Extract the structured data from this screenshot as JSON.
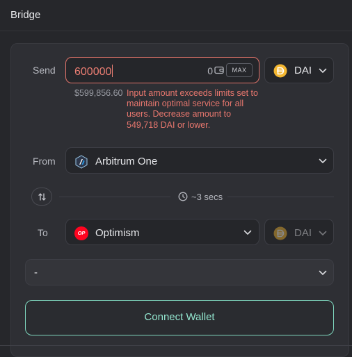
{
  "header": {
    "title": "Bridge"
  },
  "send": {
    "label": "Send",
    "amount": "600000",
    "balance": "0",
    "max_label": "MAX",
    "token": "DAI",
    "usd_value": "$599,856.60",
    "error": "Input amount exceeds limits set to maintain optimal service for all users. Decrease amount to 549,718 DAI or lower."
  },
  "from": {
    "label": "From",
    "network": "Arbitrum One"
  },
  "estimate": {
    "time": "~3 secs"
  },
  "to": {
    "label": "To",
    "network": "Optimism",
    "network_badge": "OP",
    "token": "DAI"
  },
  "route": {
    "value": "-"
  },
  "connect": {
    "label": "Connect Wallet"
  },
  "colors": {
    "accent": "#7fd8bf",
    "error": "#e8776e",
    "dai": "#f4b731",
    "optimism": "#ff0420"
  },
  "icons": [
    "wallet-icon",
    "dai-icon",
    "chevron-down-icon",
    "arbitrum-icon",
    "swap-icon",
    "clock-icon",
    "optimism-icon"
  ]
}
